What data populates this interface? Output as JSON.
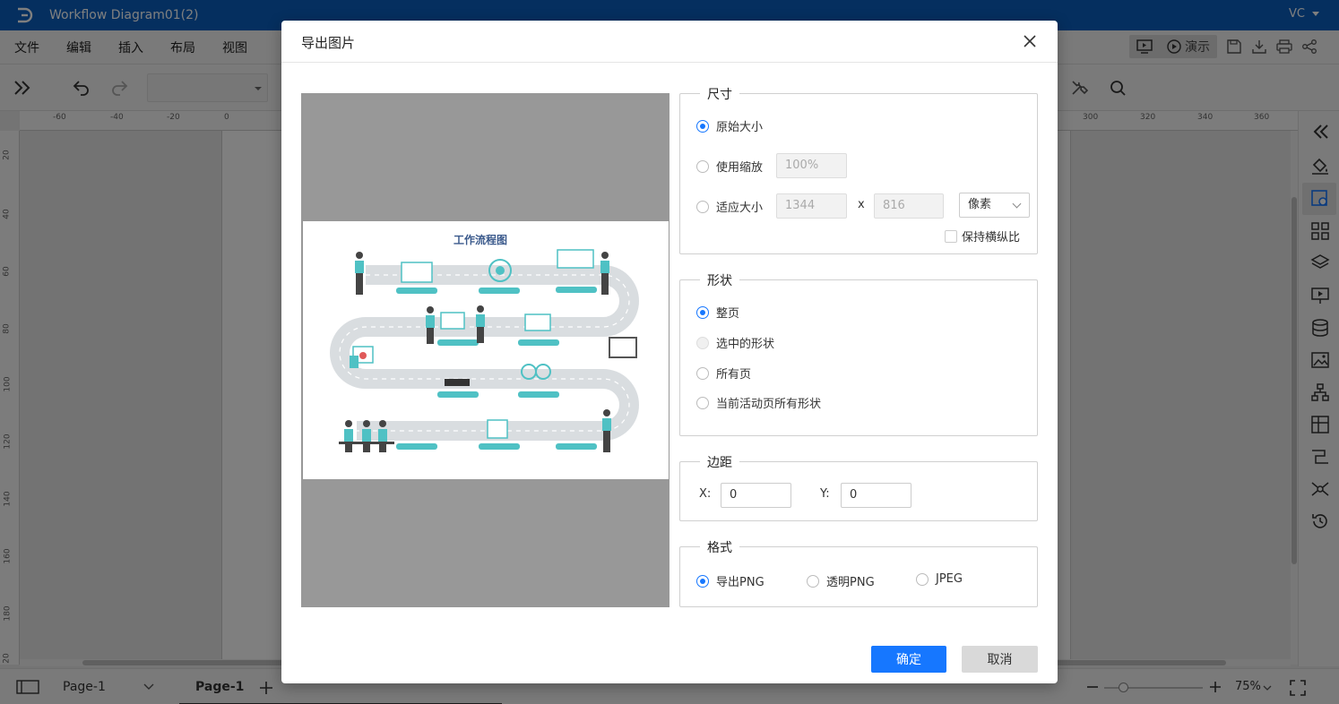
{
  "app": {
    "doc_title": "Workflow Diagram01(2)",
    "user_initials": "VC"
  },
  "menu": [
    "文件",
    "编辑",
    "插入",
    "布局",
    "视图"
  ],
  "right_tools": {
    "present_label": "演示"
  },
  "ruler": {
    "h_ticks": [
      "-60",
      "-40",
      "-20",
      "0",
      "300",
      "320",
      "340",
      "360"
    ],
    "v_ticks": [
      "20",
      "40",
      "60",
      "80",
      "100",
      "120",
      "140",
      "160",
      "180",
      "20"
    ]
  },
  "status": {
    "page_select": "Page-1",
    "page_tab": "Page-1",
    "zoom": "75%"
  },
  "dialog": {
    "title": "导出图片",
    "size": {
      "legend": "尺寸",
      "original": "原始大小",
      "use_scale": "使用缩放",
      "scale_value": "100%",
      "fit_size": "适应大小",
      "width": "1344",
      "x_label": "x",
      "height": "816",
      "unit": "像素",
      "keep_ratio": "保持横纵比"
    },
    "shape": {
      "legend": "形状",
      "whole_page": "整页",
      "selected": "选中的形状",
      "all_pages": "所有页",
      "active_page_all": "当前活动页所有形状"
    },
    "margin": {
      "legend": "边距",
      "x_label": "X:",
      "x_value": "0",
      "y_label": "Y:",
      "y_value": "0"
    },
    "format": {
      "legend": "格式",
      "png": "导出PNG",
      "transparent_png": "透明PNG",
      "jpeg": "JPEG"
    },
    "ok": "确定",
    "cancel": "取消",
    "preview_title": "工作流程图"
  },
  "colors": {
    "brand": "#0b5fbf",
    "accent": "#1677ff",
    "preview_teal": "#4fc1c4"
  }
}
